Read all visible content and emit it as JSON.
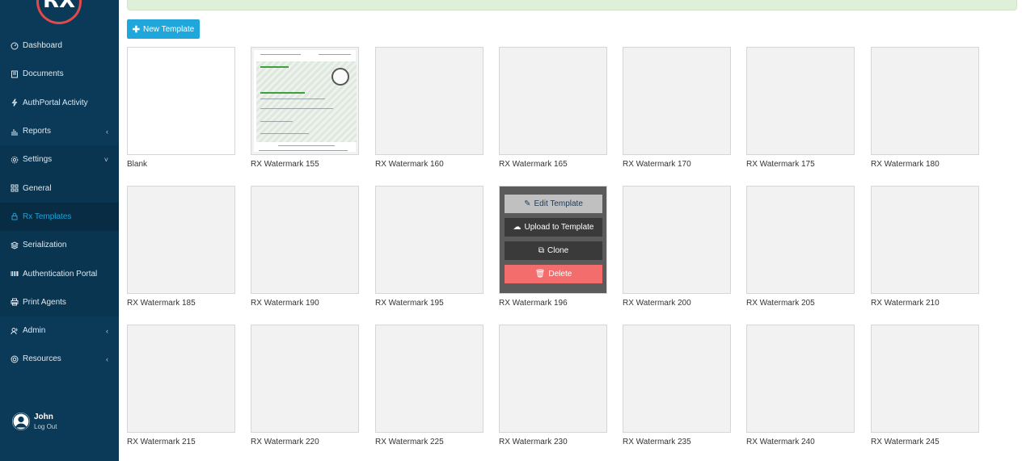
{
  "brand": {
    "logo_text": "RX"
  },
  "sidebar": {
    "items": [
      {
        "label": "Dashboard",
        "icon": "dashboard-icon"
      },
      {
        "label": "Documents",
        "icon": "documents-icon"
      },
      {
        "label": "AuthPortal Activity",
        "icon": "activity-icon"
      },
      {
        "label": "Reports",
        "icon": "reports-icon",
        "chevron": "‹"
      },
      {
        "label": "Settings",
        "icon": "gear-icon",
        "chevron": "˅"
      },
      {
        "label": "General",
        "icon": "grid-icon"
      },
      {
        "label": "Rx Templates",
        "icon": "lock-icon"
      },
      {
        "label": "Serialization",
        "icon": "layers-icon"
      },
      {
        "label": "Authentication Portal",
        "icon": "barcode-icon"
      },
      {
        "label": "Print Agents",
        "icon": "printer-icon"
      },
      {
        "label": "Admin",
        "icon": "users-icon",
        "chevron": "‹"
      },
      {
        "label": "Resources",
        "icon": "resources-icon",
        "chevron": "‹"
      }
    ],
    "active": "Rx Templates"
  },
  "user": {
    "name": "John",
    "logout": "Log Out"
  },
  "toolbar": {
    "new_template": "New Template"
  },
  "overlay": {
    "edit": "Edit Template",
    "upload": "Upload to Template",
    "clone": "Clone",
    "delete": "Delete"
  },
  "templates": [
    "Blank",
    "RX Watermark 155",
    "RX Watermark 160",
    "RX Watermark 165",
    "RX Watermark 170",
    "RX Watermark 175",
    "RX Watermark 180",
    "RX Watermark 185",
    "RX Watermark 190",
    "RX Watermark 195",
    "RX Watermark 196",
    "RX Watermark 200",
    "RX Watermark 205",
    "RX Watermark 210",
    "RX Watermark 215",
    "RX Watermark 220",
    "RX Watermark 225",
    "RX Watermark 230",
    "RX Watermark 235",
    "RX Watermark 240",
    "RX Watermark 245"
  ],
  "colors": {
    "sidebar": "#0b3a58",
    "accent": "#1fa7db",
    "delete": "#f36d6d"
  }
}
